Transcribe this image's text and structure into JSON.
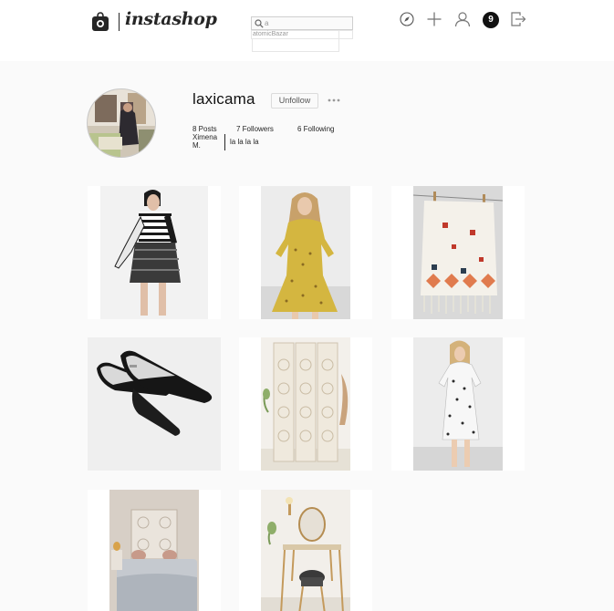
{
  "header": {
    "logo_icon": "shopping-bag-camera-icon",
    "logo_text": "instashop",
    "search": {
      "icon": "search-icon",
      "value": "a",
      "suggestions": [
        "atomicBazar",
        ""
      ]
    },
    "nav": {
      "explore_icon": "compass-icon",
      "add_icon": "plus-icon",
      "profile_icon": "user-icon",
      "notification_count": "9",
      "logout_icon": "logout-icon"
    }
  },
  "profile": {
    "username": "laxicama",
    "unfollow_label": "Unfollow",
    "more_icon": "ellipsis-icon",
    "stats": {
      "posts": "8 Posts",
      "followers": "7 Followers",
      "following": "6 Following"
    },
    "full_name": "Ximena M.",
    "bio": "la la la la"
  },
  "posts": [
    {
      "subject": "striped sweater and skirt outfit"
    },
    {
      "subject": "yellow dress"
    },
    {
      "subject": "embroidered tapestry"
    },
    {
      "subject": "black pointed flats"
    },
    {
      "subject": "white room divider screen"
    },
    {
      "subject": "white printed dress"
    },
    {
      "subject": "bedroom with carved headboard"
    },
    {
      "subject": "vanity table with mirror"
    }
  ],
  "colors": {
    "header_bg": "#ffffff",
    "page_bg": "#fafafa",
    "text": "#262626",
    "badge_bg": "#111111"
  }
}
